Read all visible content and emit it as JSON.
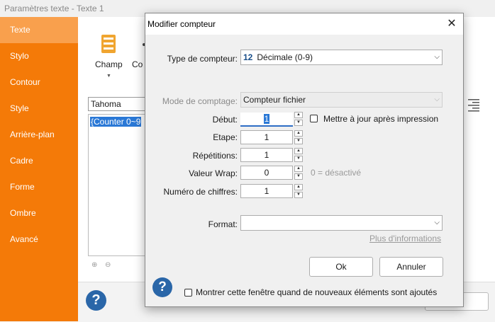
{
  "background": {
    "title": "Paramètres texte - Texte 1",
    "sidebar": [
      "Texte",
      "Stylo",
      "Contour",
      "Style",
      "Arrière-plan",
      "Cadre",
      "Forme",
      "Ombre",
      "Avancé"
    ],
    "champ_label": "Champ",
    "co_label": "Co",
    "font_name": "Tahoma",
    "counter_text": "{Counter 0~9"
  },
  "dialog": {
    "title": "Modifier compteur",
    "type_label": "Type de compteur:",
    "type_num": "12",
    "type_value": "Décimale (0-9)",
    "mode_label": "Mode de comptage:",
    "mode_value": "Compteur fichier",
    "debut_label": "Début:",
    "debut_value": "1",
    "update_label": "Mettre à jour après impression",
    "etape_label": "Etape:",
    "etape_value": "1",
    "rep_label": "Répétitions:",
    "rep_value": "1",
    "wrap_label": "Valeur Wrap:",
    "wrap_value": "0",
    "wrap_hint": "0 = désactivé",
    "digits_label": "Numéro de chiffres:",
    "digits_value": "1",
    "format_label": "Format:",
    "format_value": "",
    "more_info": "Plus d'informations",
    "ok": "Ok",
    "cancel": "Annuler",
    "show_label": "Montrer cette fenêtre quand de nouveaux éléments sont ajoutés"
  }
}
